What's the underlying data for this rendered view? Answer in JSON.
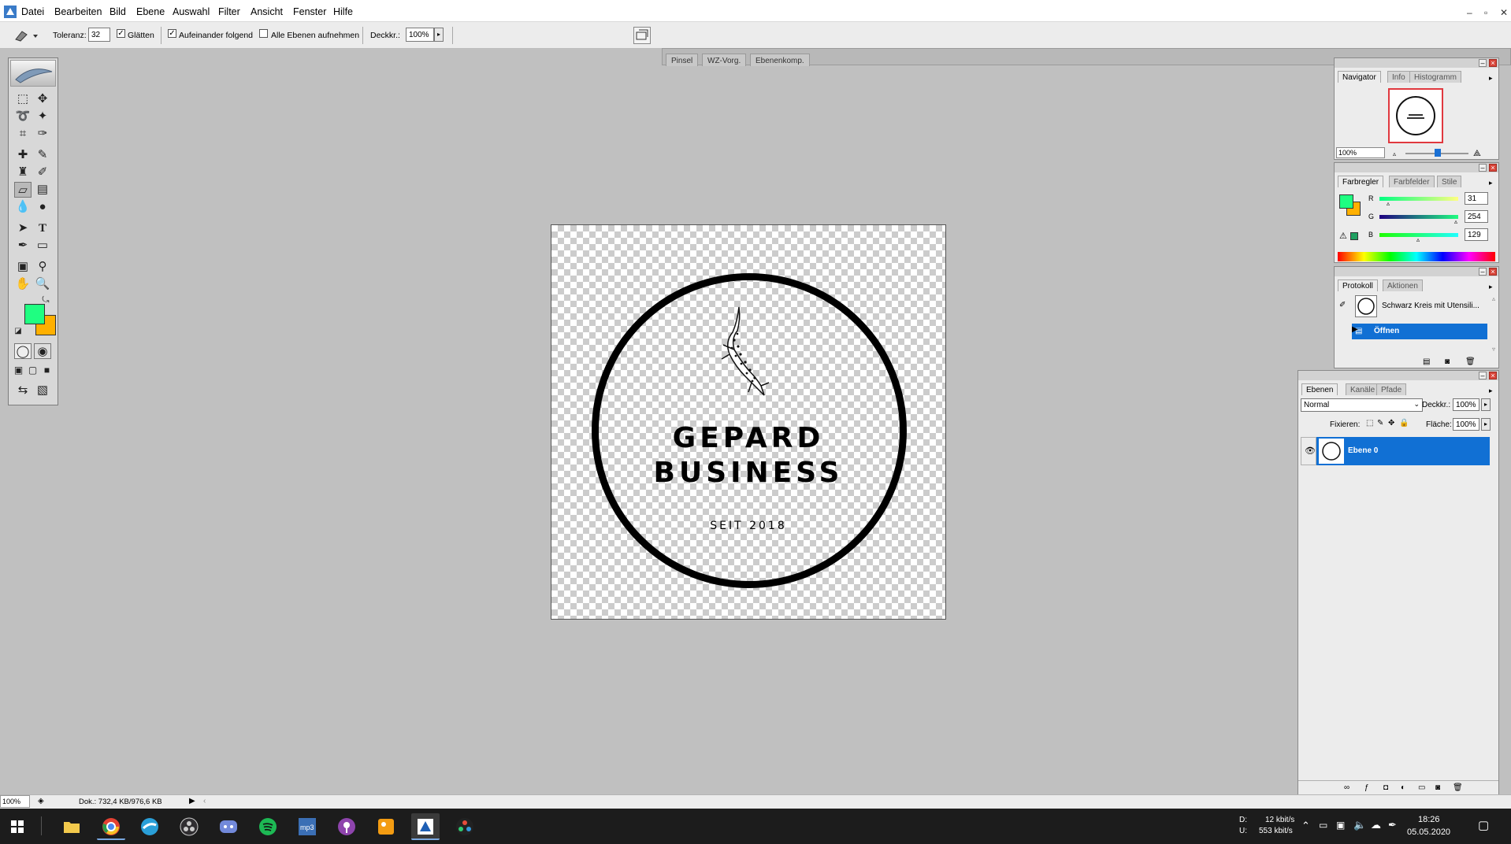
{
  "menu": {
    "items": [
      "Datei",
      "Bearbeiten",
      "Bild",
      "Ebene",
      "Auswahl",
      "Filter",
      "Ansicht",
      "Fenster",
      "Hilfe"
    ],
    "window_controls": [
      "–",
      "▫",
      "✕"
    ]
  },
  "options": {
    "toleranz_label": "Toleranz:",
    "toleranz_value": "32",
    "glaetten_label": "Glätten",
    "glaetten_checked": true,
    "aufeinander_label": "Aufeinander folgend",
    "aufeinander_checked": true,
    "alle_ebenen_label": "Alle Ebenen aufnehmen",
    "alle_ebenen_checked": false,
    "deckkr_label": "Deckkr.:",
    "deckkr_value": "100%",
    "well_tabs": [
      "Pinsel",
      "WZ-Vorg.",
      "Ebenenkomp."
    ]
  },
  "canvas": {
    "logo_line1": "GEPARD",
    "logo_line2": "BUSINESS",
    "logo_sub": "SEIT 2018"
  },
  "navigator": {
    "tabs": [
      "Navigator",
      "Info",
      "Histogramm"
    ],
    "zoom": "100%"
  },
  "color": {
    "tabs": [
      "Farbregler",
      "Farbfelder",
      "Stile"
    ],
    "r_label": "R",
    "r_value": "31",
    "g_label": "G",
    "g_value": "254",
    "b_label": "B",
    "b_value": "129",
    "foreground": "#1ffe81",
    "background": "#ffb000"
  },
  "history": {
    "tabs": [
      "Protokoll",
      "Aktionen"
    ],
    "snapshot_name": "Schwarz Kreis mit Utensili...",
    "step_name": "Öffnen"
  },
  "layers": {
    "tabs": [
      "Ebenen",
      "Kanäle",
      "Pfade"
    ],
    "blend_mode": "Normal",
    "deckkr_label": "Deckkr.:",
    "deckkr_value": "100%",
    "fixieren_label": "Fixieren:",
    "flaeche_label": "Fläche:",
    "flaeche_value": "100%",
    "layer_name": "Ebene 0"
  },
  "status": {
    "zoom": "100%",
    "doc_info": "Dok.: 732,4 KB/976,6 KB"
  },
  "taskbar": {
    "net_d_label": "D:",
    "net_u_label": "U:",
    "net_down": "12 kbit/s",
    "net_up": "553 kbit/s",
    "time": "18:26",
    "date": "05.05.2020",
    "apps": [
      "file-explorer-icon",
      "chrome-icon",
      "browser-icon",
      "obs-icon",
      "discord-icon",
      "spotify-icon",
      "mp3tag-icon",
      "podcast-icon",
      "painting-icon",
      "photoshop-icon",
      "davinci-icon"
    ]
  }
}
